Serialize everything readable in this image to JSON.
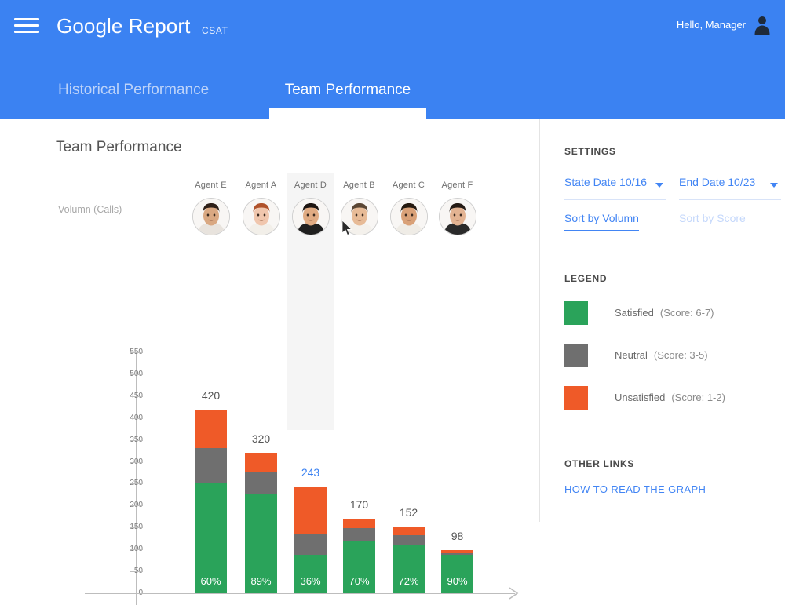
{
  "header": {
    "menu_icon": "hamburger-icon",
    "title": "Google Report",
    "subtitle": "CSAT",
    "greeting": "Hello, Manager",
    "avatar_icon": "user-avatar-icon",
    "tabs": [
      {
        "label": "Historical Performance",
        "active": false
      },
      {
        "label": "Team Performance",
        "active": true
      }
    ]
  },
  "main": {
    "chart_title": "Team Performance"
  },
  "settings": {
    "heading": "SETTINGS",
    "start_date": "State Date 10/16",
    "end_date": "End Date 10/23",
    "caret_icon": "chevron-down-icon",
    "sort_volume": "Sort by Volumn",
    "sort_score": "Sort by Score",
    "legend_heading": "LEGEND",
    "legend": [
      {
        "label": "Satisfied",
        "score": "(Score: 6-7)",
        "color": "#2aa35a"
      },
      {
        "label": "Neutral",
        "score": "(Score: 3-5)",
        "color": "#6f6f6f"
      },
      {
        "label": "Unsatisfied",
        "score": "(Score: 1-2)",
        "color": "#ef5a28"
      }
    ],
    "other_links_heading": "OTHER LINKS",
    "other_links": [
      {
        "label": "HOW TO READ THE GRAPH"
      }
    ]
  },
  "chart_data": {
    "type": "bar",
    "stacked": true,
    "title": "Team Performance",
    "xlabel": "",
    "ylabel": "Volumn (Calls)",
    "ylim": [
      0,
      550
    ],
    "yticks": [
      550,
      500,
      450,
      400,
      350,
      300,
      250,
      200,
      150,
      100,
      50,
      0
    ],
    "grid": false,
    "legend_position": "right-panel",
    "categories": [
      "Agent E",
      "Agent A",
      "Agent D",
      "Agent B",
      "Agent C",
      "Agent F"
    ],
    "totals": [
      420,
      320,
      243,
      170,
      152,
      98
    ],
    "satisfied_percent_labels": [
      "60%",
      "89%",
      "36%",
      "70%",
      "72%",
      "90%"
    ],
    "highlighted_category": "Agent D",
    "series": [
      {
        "name": "Satisfied",
        "color": "#2aa35a",
        "values": [
          252,
          228,
          87,
          119,
          109,
          88
        ]
      },
      {
        "name": "Neutral",
        "color": "#6f6f6f",
        "values": [
          80,
          50,
          49,
          29,
          24,
          4
        ]
      },
      {
        "name": "Unsatisfied",
        "color": "#ef5a28",
        "values": [
          88,
          42,
          107,
          22,
          19,
          6
        ]
      }
    ]
  }
}
